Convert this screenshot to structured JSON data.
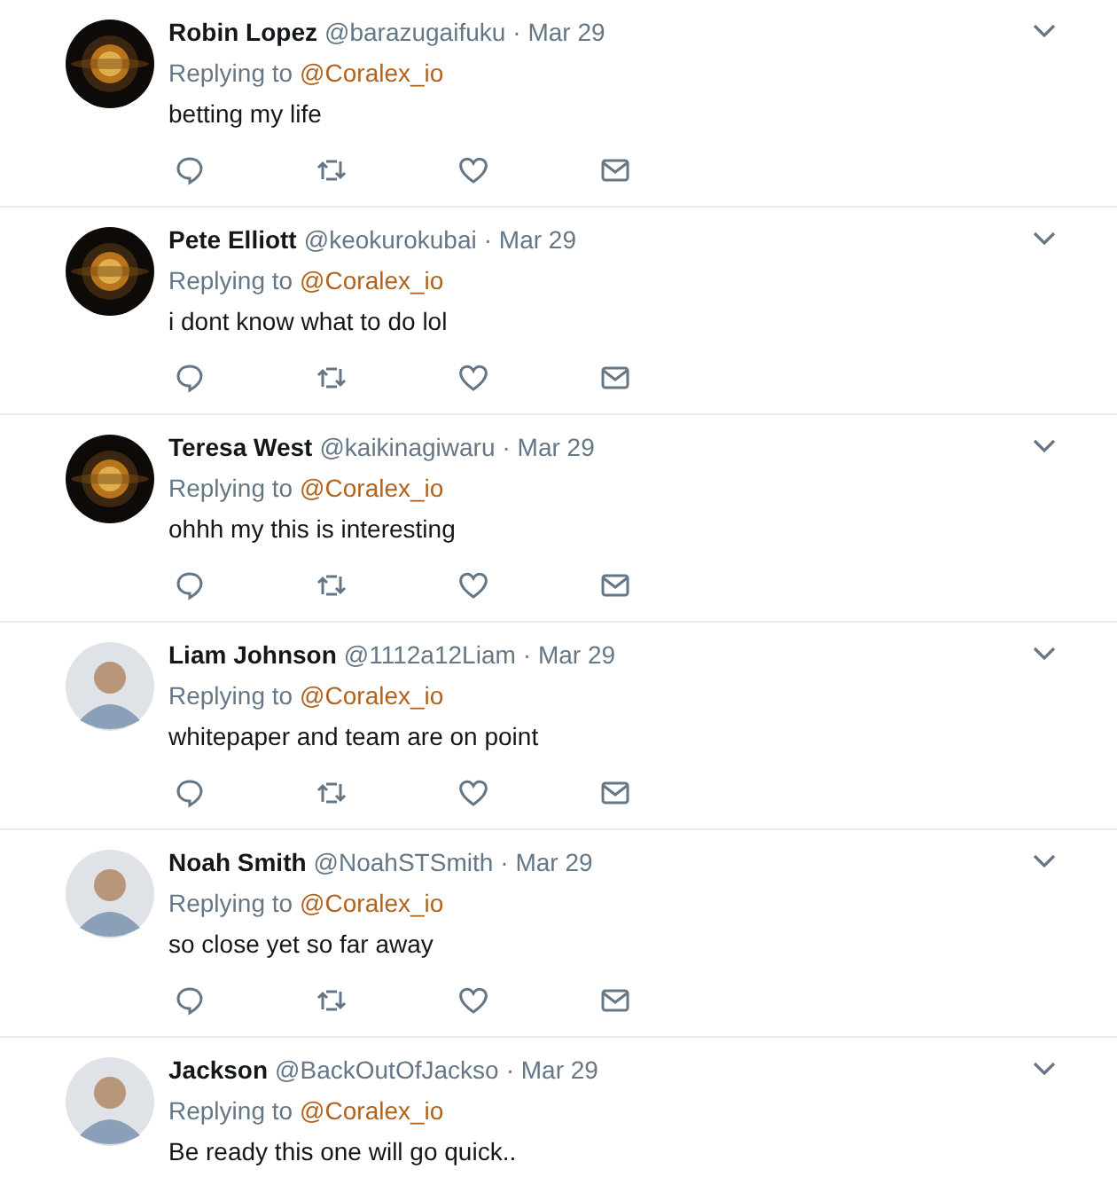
{
  "tweets": [
    {
      "avatar": {
        "kind": "coin"
      },
      "name": "Robin Lopez",
      "handle": "@barazugaifuku",
      "date": "· Mar 29",
      "replying": "Replying to",
      "reply_to": "@Coralex_io",
      "text": "betting my life",
      "show_actions": true
    },
    {
      "avatar": {
        "kind": "coin"
      },
      "name": "Pete Elliott",
      "handle": "@keokurokubai",
      "date": "· Mar 29",
      "replying": "Replying to",
      "reply_to": "@Coralex_io",
      "text": "i dont know what to do lol",
      "show_actions": true
    },
    {
      "avatar": {
        "kind": "coin"
      },
      "name": "Teresa West",
      "handle": "@kaikinagiwaru",
      "date": "· Mar 29",
      "replying": "Replying to",
      "reply_to": "@Coralex_io",
      "text": "ohhh my this is interesting",
      "show_actions": true
    },
    {
      "avatar": {
        "kind": "person"
      },
      "name": "Liam Johnson",
      "handle": "@1112a12Liam",
      "date": "· Mar 29",
      "replying": "Replying to",
      "reply_to": "@Coralex_io",
      "text": "whitepaper and team are on point",
      "show_actions": true
    },
    {
      "avatar": {
        "kind": "person"
      },
      "name": "Noah Smith",
      "handle": "@NoahSTSmith",
      "date": "· Mar 29",
      "replying": "Replying to",
      "reply_to": "@Coralex_io",
      "text": "so close yet so far away",
      "show_actions": true
    },
    {
      "avatar": {
        "kind": "person"
      },
      "name": "Jackson",
      "handle": "@BackOutOfJackso",
      "date": "· Mar 29",
      "replying": "Replying to",
      "reply_to": "@Coralex_io",
      "text": "Be ready this one will go quick..",
      "show_actions": false
    }
  ]
}
